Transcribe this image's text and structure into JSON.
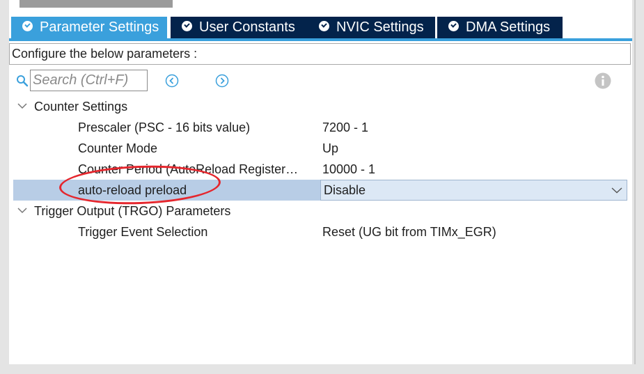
{
  "tabs": [
    {
      "label": "Parameter Settings",
      "active": true
    },
    {
      "label": "User Constants",
      "active": false
    },
    {
      "label": "NVIC Settings",
      "active": false
    },
    {
      "label": "DMA Settings",
      "active": false
    }
  ],
  "configure_label": "Configure the below parameters :",
  "search": {
    "placeholder": "Search (Ctrl+F)"
  },
  "groups": [
    {
      "title": "Counter Settings",
      "params": [
        {
          "name": "Prescaler (PSC - 16 bits value)",
          "value": "7200 - 1"
        },
        {
          "name": "Counter Mode",
          "value": "Up"
        },
        {
          "name": "Counter Period (AutoReload Register…",
          "value": "10000 - 1"
        },
        {
          "name": "auto-reload preload",
          "value": "Disable"
        }
      ]
    },
    {
      "title": "Trigger Output (TRGO) Parameters",
      "params": [
        {
          "name": "Trigger Event Selection",
          "value": "Reset (UG bit from TIMx_EGR)"
        }
      ]
    }
  ],
  "colors": {
    "tab_active": "#3aa0dc",
    "tab_inactive": "#03234b",
    "selected_row": "#b8cde6",
    "annotation": "#e5262d"
  },
  "icons": [
    "check-circle-icon",
    "search-icon",
    "prev-icon",
    "next-icon",
    "info-icon",
    "chevron-down-icon"
  ]
}
